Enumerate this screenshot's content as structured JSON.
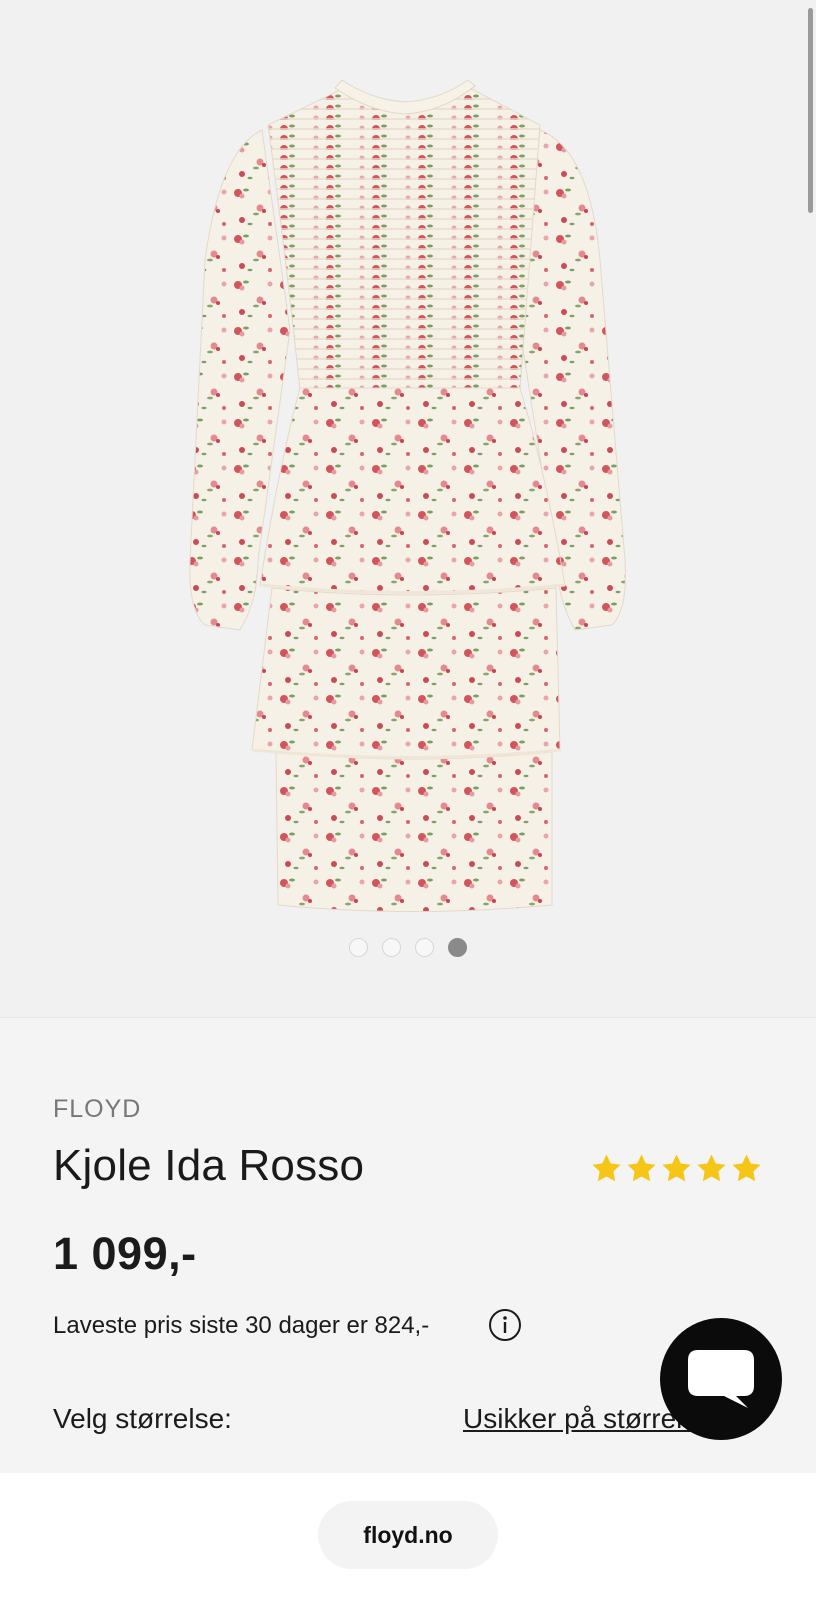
{
  "gallery": {
    "image_alt": "Kjole Ida Rosso",
    "total_images": 4,
    "active_index": 3
  },
  "product": {
    "brand": "FLOYD",
    "title": "Kjole Ida Rosso",
    "rating": 5,
    "max_rating": 5,
    "price": "1 099,-",
    "lowest_price_note": "Laveste pris siste 30 dager er 824,-",
    "size_label": "Velg størrelse:",
    "size_guide_link": "Usikker på størrelse?"
  },
  "browser": {
    "url": "floyd.no"
  },
  "colors": {
    "star": "#f5c518",
    "chat_button": "#0b0b0b",
    "background": "#f4f4f4"
  },
  "icons": [
    "info-icon",
    "chat-icon",
    "star-icon"
  ]
}
